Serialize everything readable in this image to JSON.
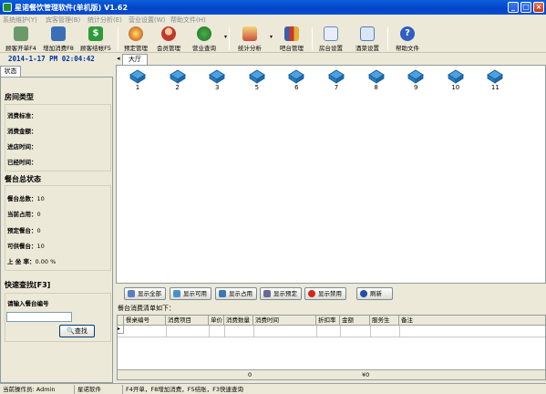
{
  "window": {
    "title": "星诺餐饮管理软件(单机版)   V1.62"
  },
  "menu": [
    "系统维护(Y)",
    "宾客管理(B)",
    "统计分析(E)",
    "营业设置(W)",
    "帮助文件(H)"
  ],
  "toolbar": {
    "open_table": "顾客开单F4",
    "add_consume": "增加消费F8",
    "checkout": "顾客结帐F5",
    "reserve": "预定管理",
    "member": "会员管理",
    "business_query": "营业查询",
    "statistics": "统计分析",
    "bar_manage": "吧台管理",
    "room_settings": "房台设置",
    "menu_settings": "酒菜设置",
    "help": "帮助文件"
  },
  "left": {
    "datetime": "2014-1-17 PM 02:04:42",
    "tab": "状态",
    "room_type_title": "房间类型",
    "room_fields": [
      "消费标准：",
      "消费金额：",
      "进店时间：",
      "已经时间："
    ],
    "table_status_title": "餐台总状态",
    "table_stats": [
      {
        "label": "餐台总数：",
        "value": "10"
      },
      {
        "label": "当前占用：",
        "value": "0"
      },
      {
        "label": "预定餐台：",
        "value": "0"
      },
      {
        "label": "可供餐台：",
        "value": "10"
      },
      {
        "label": "上 坐 率：",
        "value": "0.00 %"
      }
    ],
    "quick_search_title": "快速查找[F3]",
    "search_prompt": "请输入餐台编号",
    "search_button": "查找"
  },
  "hall": {
    "tab": "大厅",
    "tables": [
      "1",
      "2",
      "3",
      "5",
      "6",
      "7",
      "8",
      "9",
      "10",
      "11"
    ]
  },
  "actions": {
    "show_all": "显示全部",
    "show_available": "显示可用",
    "show_occupied": "显示占用",
    "show_reserved": "显示预定",
    "show_disabled": "显示禁用",
    "refresh": "刷新"
  },
  "consume_list": {
    "caption": "餐台消费清单如下：",
    "columns": [
      "餐桌编号",
      "消费项目",
      "单价",
      "消费数量",
      "消费时间",
      "折扣率",
      "金额",
      "服务生",
      "备注"
    ],
    "footer_qty": "0",
    "footer_amount": "¥0"
  },
  "statusbar": {
    "operator": "当前操作员: Admin",
    "company": "星诺软件",
    "hint": "F4开单，F8增加消费，F5结账，F3快速查询"
  }
}
